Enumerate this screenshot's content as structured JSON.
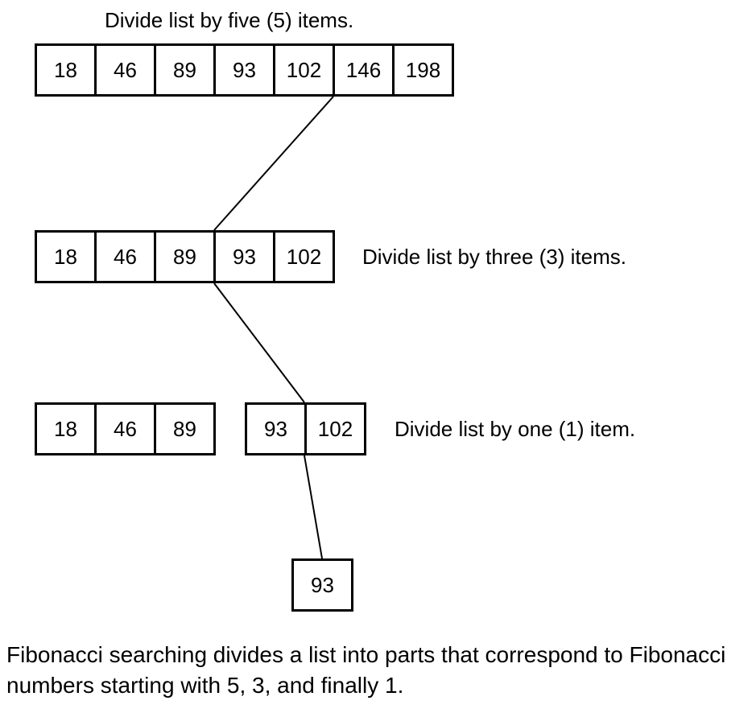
{
  "labels": {
    "step1": "Divide list by five (5) items.",
    "step2": "Divide list by three (3) items.",
    "step3": "Divide list by one (1) item."
  },
  "rows": {
    "r1": [
      "18",
      "46",
      "89",
      "93",
      "102",
      "146",
      "198"
    ],
    "r2": [
      "18",
      "46",
      "89",
      "93",
      "102"
    ],
    "r3a": [
      "18",
      "46",
      "89"
    ],
    "r3b": [
      "93",
      "102"
    ],
    "r4": [
      "93"
    ]
  },
  "caption": "Fibonacci searching divides a list into parts that correspond to Fibonacci numbers starting with 5, 3, and finally 1."
}
